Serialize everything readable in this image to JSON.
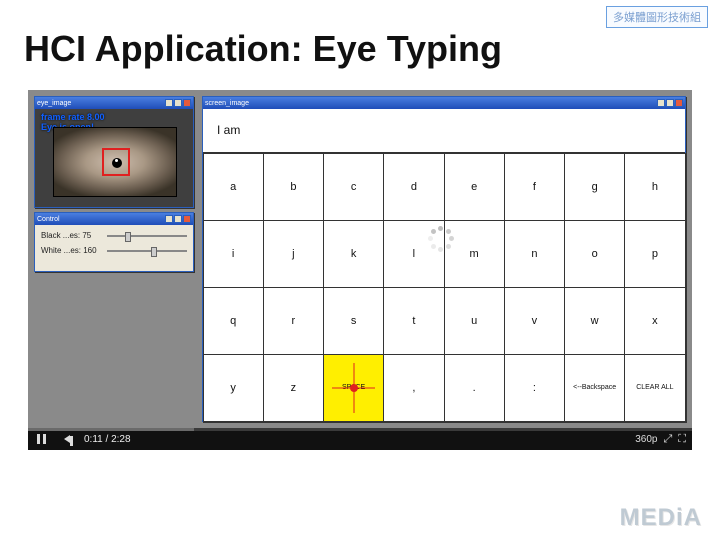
{
  "corner_badge": "多媒體圖形技術組",
  "title": "HCI Application: Eye Typing",
  "eye_window": {
    "title": "eye_image",
    "frame_rate_label": "frame rate 8.00",
    "eye_state_label": "Eye is open!"
  },
  "control_window": {
    "title": "Control",
    "slider1_label": "Black ...es: 75",
    "slider2_label": "White ...es: 160"
  },
  "keyboard_window": {
    "title": "screen_image",
    "typed_text": "I am",
    "rows": [
      [
        "a",
        "b",
        "c",
        "d",
        "e",
        "f",
        "g",
        "h"
      ],
      [
        "i",
        "j",
        "k",
        "l",
        "m",
        "n",
        "o",
        "p"
      ],
      [
        "q",
        "r",
        "s",
        "t",
        "u",
        "v",
        "w",
        "x"
      ],
      [
        "y",
        "z",
        "SPACE",
        ",",
        ".",
        ":",
        "<--Backspace",
        "CLEAR ALL"
      ]
    ],
    "selected": {
      "row": 3,
      "col": 2
    }
  },
  "video": {
    "elapsed": "0:11",
    "total": "2:28",
    "quality_label": "360p"
  },
  "watermark": "MEDiA"
}
